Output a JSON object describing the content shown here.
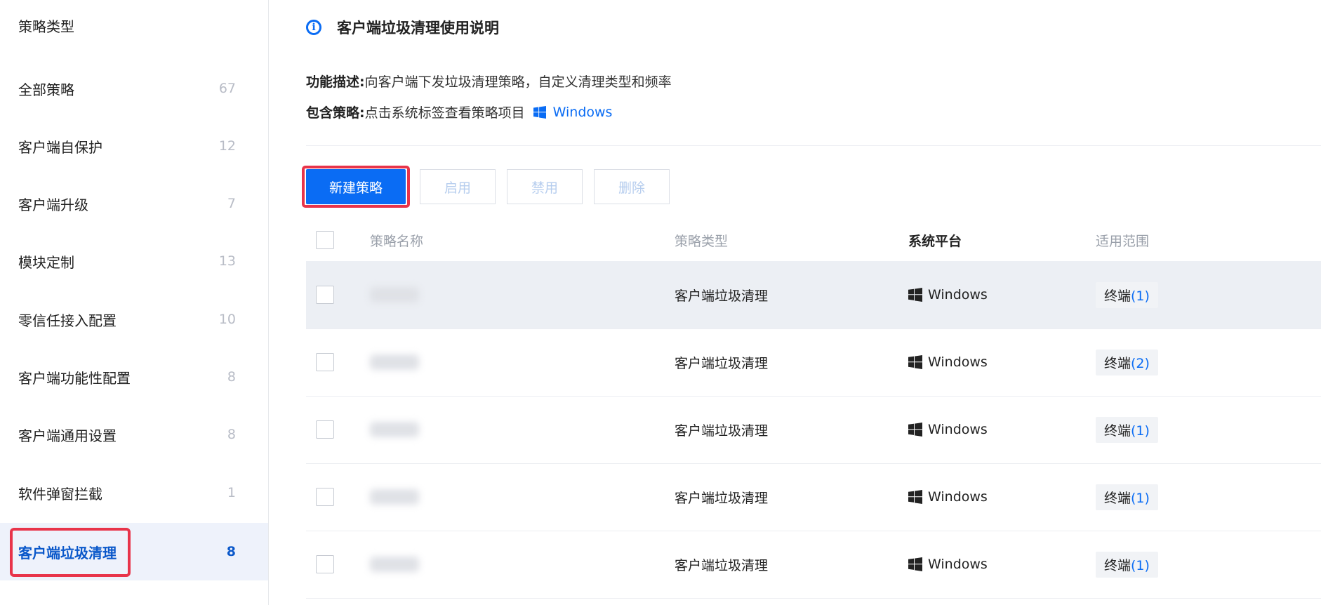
{
  "colors": {
    "accent": "#0a6cf4",
    "highlight_outline": "#e8344a",
    "sidebar_active_bg": "#eef2fb"
  },
  "sidebar": {
    "title": "策略类型",
    "items": [
      {
        "label": "全部策略",
        "count": "67"
      },
      {
        "label": "客户端自保护",
        "count": "12"
      },
      {
        "label": "客户端升级",
        "count": "7"
      },
      {
        "label": "模块定制",
        "count": "13"
      },
      {
        "label": "零信任接入配置",
        "count": "10"
      },
      {
        "label": "客户端功能性配置",
        "count": "8"
      },
      {
        "label": "客户端通用设置",
        "count": "8"
      },
      {
        "label": "软件弹窗拦截",
        "count": "1"
      },
      {
        "label": "客户端垃圾清理",
        "count": "8",
        "active": true
      }
    ]
  },
  "info": {
    "icon": "info-icon",
    "title": "客户端垃圾清理使用说明",
    "desc_key": "功能描述:",
    "desc_value": "向客户端下发垃圾清理策略，自定义清理类型和频率",
    "include_key": "包含策略:",
    "include_value": "点击系统标签查看策略项目",
    "platform_link": "Windows"
  },
  "toolbar": {
    "new": "新建策略",
    "enable": "启用",
    "disable": "禁用",
    "delete": "删除"
  },
  "table": {
    "headers": {
      "name": "策略名称",
      "type": "策略类型",
      "platform": "系统平台",
      "scope": "适用范围"
    },
    "rows": [
      {
        "type": "客户端垃圾清理",
        "platform": "Windows",
        "scope_label": "终端",
        "scope_count": "(1)"
      },
      {
        "type": "客户端垃圾清理",
        "platform": "Windows",
        "scope_label": "终端",
        "scope_count": "(2)"
      },
      {
        "type": "客户端垃圾清理",
        "platform": "Windows",
        "scope_label": "终端",
        "scope_count": "(1)"
      },
      {
        "type": "客户端垃圾清理",
        "platform": "Windows",
        "scope_label": "终端",
        "scope_count": "(1)"
      },
      {
        "type": "客户端垃圾清理",
        "platform": "Windows",
        "scope_label": "终端",
        "scope_count": "(1)"
      }
    ]
  }
}
